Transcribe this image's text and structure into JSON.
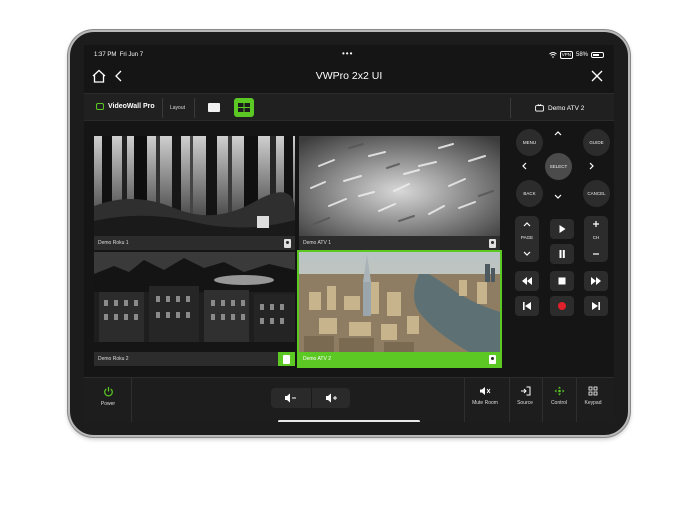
{
  "status": {
    "time": "1:37 PM",
    "date": "Fri Jun 7",
    "battery": "58%",
    "vpn": "VPN"
  },
  "nav": {
    "title": "VWPro 2x2 UI"
  },
  "toolbar": {
    "brand": "VideoWall Pro",
    "layout_label": "Layout",
    "source_name": "Demo ATV 2"
  },
  "tiles": [
    {
      "label": "Demo Roku 1"
    },
    {
      "label": "Demo ATV 1"
    },
    {
      "label": "Demo Roku 2"
    },
    {
      "label": "Demo ATV 2",
      "active": true
    }
  ],
  "remote": {
    "menu": "MENU",
    "guide": "GUIDE",
    "select": "SELECT",
    "back": "BACK",
    "cancel": "CANCEL",
    "page": "PAGE",
    "ch": "CH"
  },
  "bottom": {
    "power": "Power",
    "mute_room": "Mute Room",
    "source": "Source",
    "control": "Control",
    "keypad": "Keypad"
  },
  "colors": {
    "accent": "#5cc824",
    "record": "#e0202a",
    "background": "#151515"
  }
}
